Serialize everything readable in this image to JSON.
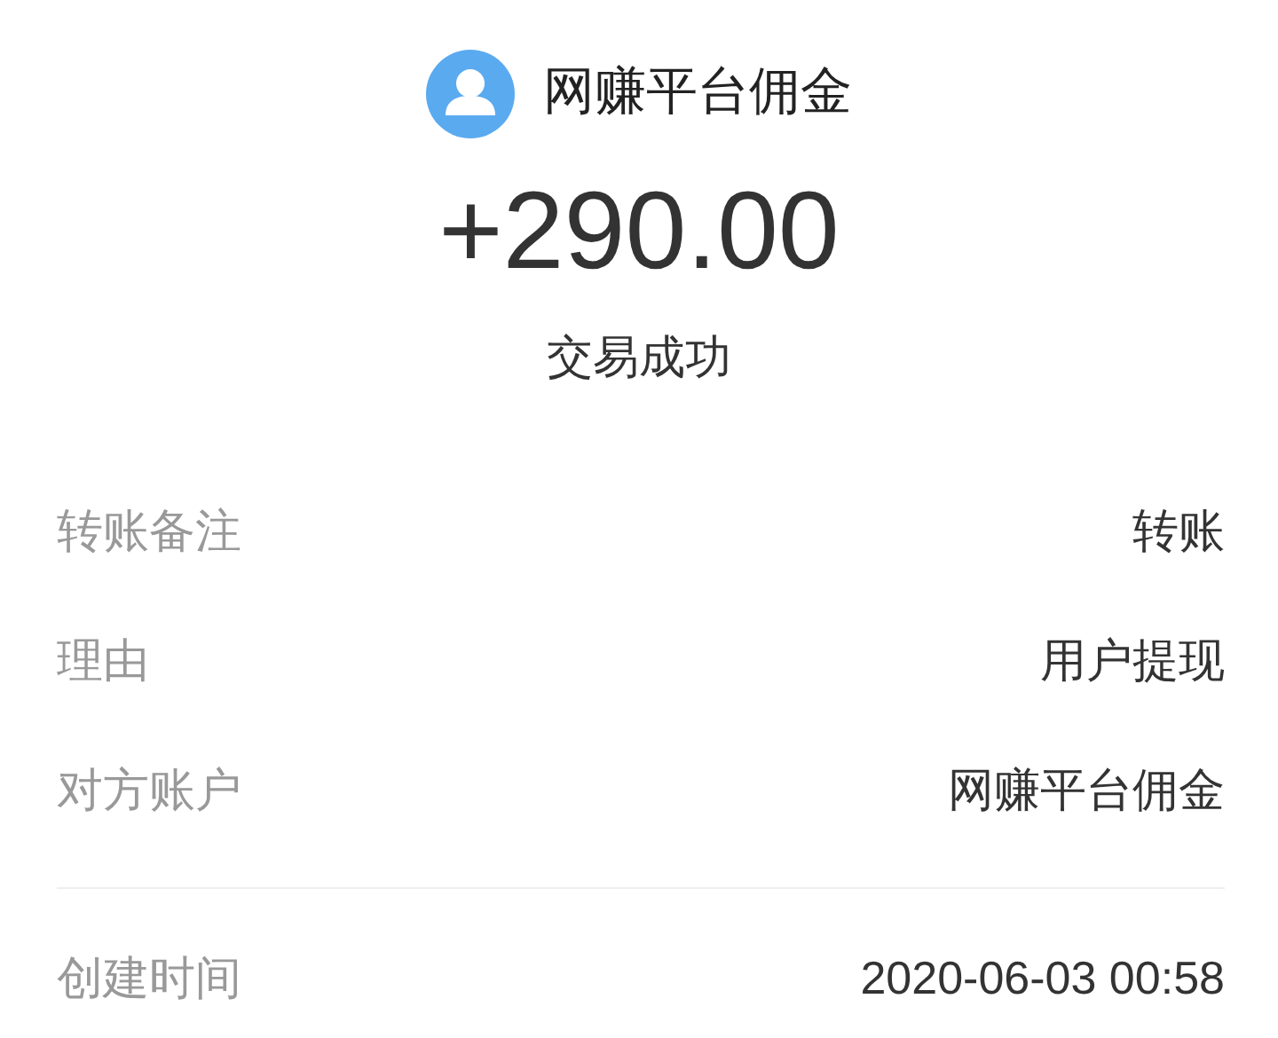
{
  "payee": {
    "name": "网赚平台佣金"
  },
  "amount": "+290.00",
  "status": "交易成功",
  "details": [
    {
      "label": "转账备注",
      "value": "转账"
    },
    {
      "label": "理由",
      "value": "用户提现"
    },
    {
      "label": "对方账户",
      "value": "网赚平台佣金"
    }
  ],
  "extra": [
    {
      "label": "创建时间",
      "value": "2020-06-03 00:58"
    }
  ]
}
